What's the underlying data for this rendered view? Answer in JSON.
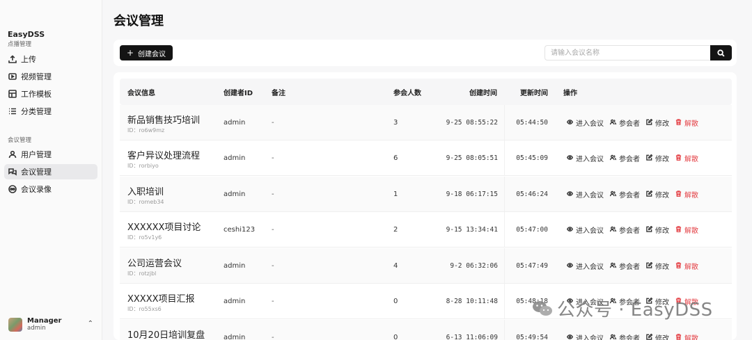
{
  "app": {
    "name": "EasyDSS"
  },
  "sidebar": {
    "sections": [
      {
        "label": "点播管理",
        "items": [
          {
            "label": "上传",
            "icon": "upload-icon"
          },
          {
            "label": "视频管理",
            "icon": "video-icon"
          },
          {
            "label": "工作模板",
            "icon": "template-icon"
          },
          {
            "label": "分类管理",
            "icon": "list-icon"
          }
        ]
      },
      {
        "label": "会议管理",
        "items": [
          {
            "label": "用户管理",
            "icon": "user-icon"
          },
          {
            "label": "会议管理",
            "icon": "meeting-icon",
            "active": true
          },
          {
            "label": "会议录像",
            "icon": "record-icon"
          }
        ]
      }
    ],
    "user": {
      "name": "Manager",
      "role": "admin"
    }
  },
  "page": {
    "title": "会议管理"
  },
  "toolbar": {
    "create_label": "创建会议",
    "search_placeholder": "请输入会议名称"
  },
  "table": {
    "headers": {
      "info": "会议信息",
      "creator": "创建者ID",
      "note": "备注",
      "count": "参会人数",
      "created": "创建时间",
      "updated": "更新时间",
      "actions": "操作"
    },
    "action_labels": {
      "enter": "进入会议",
      "participants": "参会者",
      "edit": "修改",
      "dismiss": "解散"
    },
    "rows": [
      {
        "name": "新品销售技巧培训",
        "id": "ID：ro6w9mz",
        "creator": "admin",
        "note": "-",
        "count": "3",
        "created": "9-25 08:55:22",
        "updated": "05:44:50"
      },
      {
        "name": "客户异议处理流程",
        "id": "ID：rorbiyo",
        "creator": "admin",
        "note": "-",
        "count": "6",
        "created": "9-25 08:05:51",
        "updated": "05:45:09"
      },
      {
        "name": "入职培训",
        "id": "ID：romeb34",
        "creator": "admin",
        "note": "-",
        "count": "1",
        "created": "9-18 06:17:15",
        "updated": "05:46:24"
      },
      {
        "name": "XXXXXX项目讨论",
        "id": "ID：ro5v1y6",
        "creator": "ceshi123",
        "note": "-",
        "count": "2",
        "created": "9-15 13:34:41",
        "updated": "05:47:00"
      },
      {
        "name": "公司运营会议",
        "id": "ID：rotzjbl",
        "creator": "admin",
        "note": "-",
        "count": "4",
        "created": "9-2 06:32:06",
        "updated": "05:47:49"
      },
      {
        "name": "XXXXX项目汇报",
        "id": "ID：ro55xs6",
        "creator": "admin",
        "note": "-",
        "count": "0",
        "created": "8-28 10:11:48",
        "updated": "05:48:18"
      },
      {
        "name": "10月20日培训复盘",
        "id": "",
        "creator": "admin",
        "note": "-",
        "count": "0",
        "created": "6-13 11:06:09",
        "updated": "05:49:54"
      }
    ]
  },
  "watermark": {
    "text": "公众号 · EasyDSS"
  },
  "colors": {
    "primary": "#141414",
    "danger": "#e5484d",
    "active_nav": "#e9e9eb"
  }
}
